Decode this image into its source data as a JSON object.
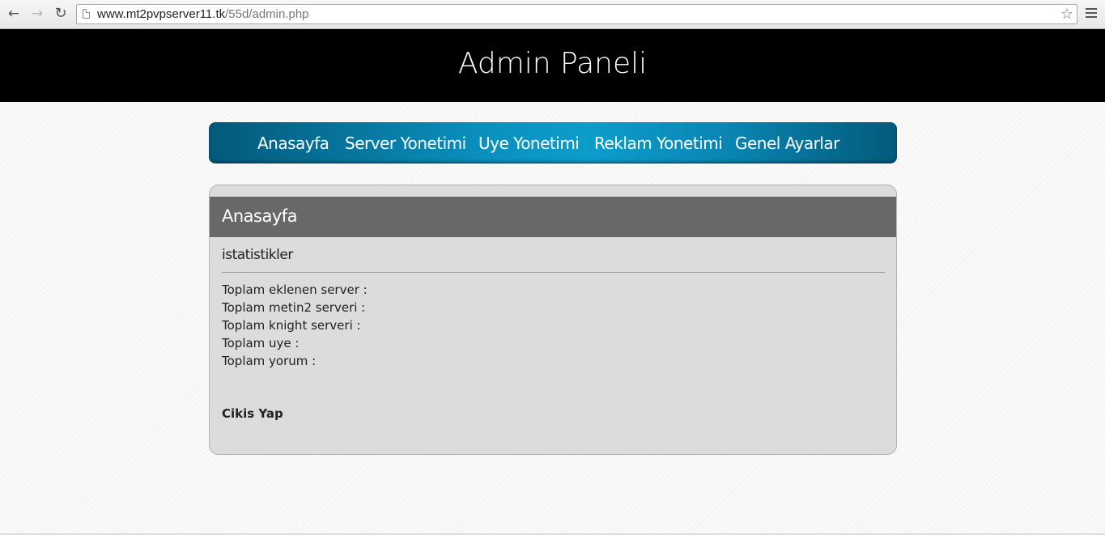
{
  "browser": {
    "url_host": "www.mt2pvpserver11.tk",
    "url_path": "/55d/admin.php",
    "back_icon": "back-arrow-icon",
    "forward_icon": "forward-arrow-icon",
    "reload_icon": "reload-icon",
    "star_icon": "star-icon",
    "menu_icon": "hamburger-menu-icon"
  },
  "header": {
    "title": "Admin Paneli"
  },
  "nav": {
    "items": [
      {
        "label": "Anasayfa"
      },
      {
        "label": "Server Yonetimi"
      },
      {
        "label": "Uye Yonetimi"
      },
      {
        "label": "Reklam Yonetimi"
      },
      {
        "label": "Genel Ayarlar"
      }
    ]
  },
  "panel": {
    "title": "Anasayfa",
    "section_title": "istatistikler",
    "stats": [
      {
        "label": "Toplam eklenen server :"
      },
      {
        "label": "Toplam metin2 serveri :"
      },
      {
        "label": "Toplam knight serveri :"
      },
      {
        "label": "Toplam uye :"
      },
      {
        "label": "Toplam yorum :"
      }
    ],
    "logout_label": "Cikis Yap"
  },
  "colors": {
    "header_bg": "#000000",
    "nav_accent": "#0c9dcb",
    "panel_header_bg": "#686868",
    "panel_bg": "#dcdcdc"
  }
}
